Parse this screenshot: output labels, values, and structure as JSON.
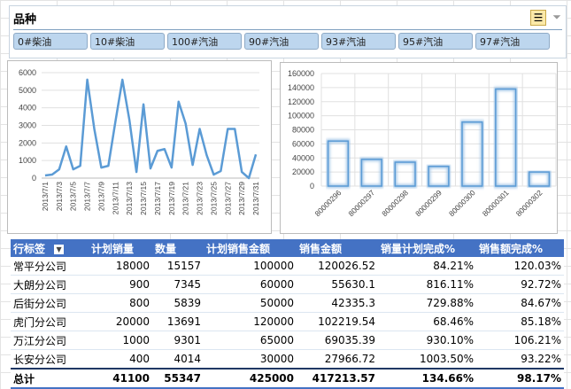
{
  "slicer": {
    "title": "品种",
    "items": [
      "0#柴油",
      "10#柴油",
      "100#汽油",
      "90#汽油",
      "93#汽油",
      "95#汽油",
      "97#汽油"
    ],
    "icons": [
      "multi-select-icon",
      "clear-filter-icon"
    ]
  },
  "chart_data": [
    {
      "type": "line",
      "title": "",
      "ylim": [
        0,
        6000
      ],
      "yticks": [
        0,
        1000,
        2000,
        3000,
        4000,
        5000,
        6000
      ],
      "color": "#5b9bd5",
      "x": [
        "2013/7/1",
        "2013/7/2",
        "2013/7/3",
        "2013/7/4",
        "2013/7/5",
        "2013/7/6",
        "2013/7/7",
        "2013/7/8",
        "2013/7/9",
        "2013/7/10",
        "2013/7/11",
        "2013/7/12",
        "2013/7/13",
        "2013/7/14",
        "2013/7/15",
        "2013/7/16",
        "2013/7/17",
        "2013/7/18",
        "2013/7/19",
        "2013/7/20",
        "2013/7/21",
        "2013/7/22",
        "2013/7/23",
        "2013/7/24",
        "2013/7/25",
        "2013/7/26",
        "2013/7/27",
        "2013/7/28",
        "2013/7/29",
        "2013/7/30",
        "2013/7/31"
      ],
      "values": [
        150,
        200,
        500,
        1800,
        500,
        700,
        5600,
        2800,
        600,
        700,
        3200,
        5600,
        3300,
        350,
        4200,
        550,
        1550,
        1650,
        600,
        4350,
        3100,
        750,
        2800,
        1300,
        200,
        400,
        2800,
        2800,
        350,
        0,
        1350
      ]
    },
    {
      "type": "bar",
      "title": "",
      "ylim": [
        0,
        160000
      ],
      "yticks": [
        0,
        20000,
        40000,
        60000,
        80000,
        100000,
        120000,
        140000,
        160000
      ],
      "color": "#5b9bd5",
      "categories": [
        "80000296",
        "80000297",
        "80000298",
        "80000299",
        "80000300",
        "80000301",
        "80000302"
      ],
      "values": [
        64000,
        38000,
        34000,
        28000,
        91000,
        138000,
        20000
      ]
    }
  ],
  "table": {
    "headers": [
      "行标签",
      "计划销量",
      "数量",
      "计划销售金额",
      "销售金额",
      "销量计划完成%",
      "销售额完成%"
    ],
    "rows": [
      [
        "常平分公司",
        "18000",
        "15157",
        "100000",
        "120026.52",
        "84.21%",
        "120.03%"
      ],
      [
        "大朗分公司",
        "900",
        "7345",
        "60000",
        "55630.1",
        "816.11%",
        "92.72%"
      ],
      [
        "后街分公司",
        "800",
        "5839",
        "50000",
        "42335.3",
        "729.88%",
        "84.67%"
      ],
      [
        "虎门分公司",
        "20000",
        "13691",
        "120000",
        "102219.54",
        "68.46%",
        "85.18%"
      ],
      [
        "万江分公司",
        "1000",
        "9301",
        "65000",
        "69035.39",
        "930.10%",
        "106.21%"
      ],
      [
        "长安分公司",
        "400",
        "4014",
        "30000",
        "27966.72",
        "1003.50%",
        "93.22%"
      ]
    ],
    "total": [
      "总计",
      "41100",
      "55347",
      "425000",
      "417213.57",
      "134.66%",
      "98.17%"
    ]
  }
}
